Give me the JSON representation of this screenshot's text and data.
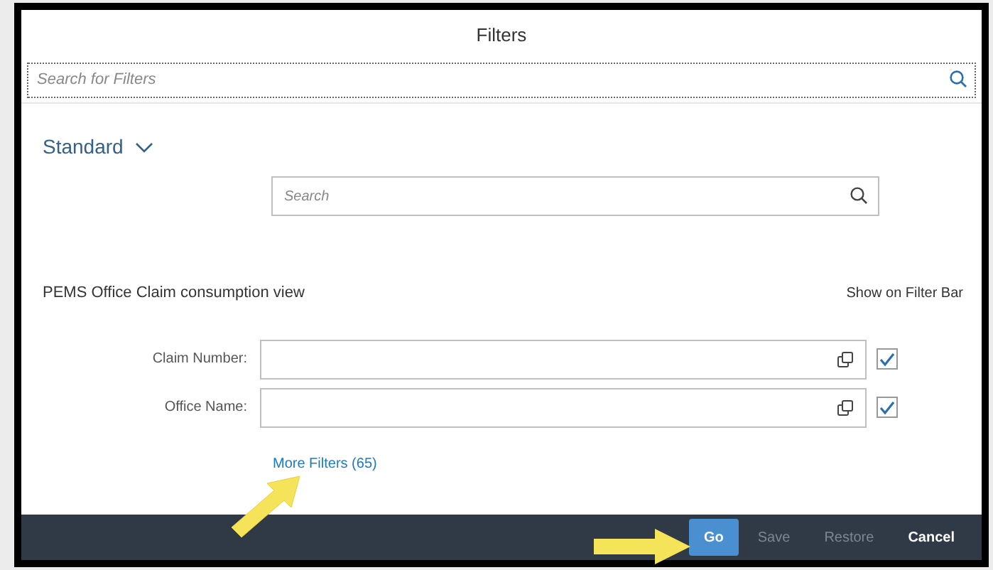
{
  "dialog": {
    "title": "Filters"
  },
  "filter_search": {
    "placeholder": "Search for Filters"
  },
  "variant": {
    "label": "Standard"
  },
  "list_search": {
    "placeholder": "Search"
  },
  "group": {
    "title": "PEMS Office Claim consumption view",
    "column_header": "Show on Filter Bar"
  },
  "fields": [
    {
      "label": "Claim Number:",
      "checked": true
    },
    {
      "label": "Office Name:",
      "checked": true
    }
  ],
  "more_filters": "More Filters (65)",
  "footer_buttons": [
    {
      "label": "Go",
      "kind": "primary",
      "disabled": false
    },
    {
      "label": "Save",
      "kind": "plain",
      "disabled": true
    },
    {
      "label": "Restore",
      "kind": "plain",
      "disabled": true
    },
    {
      "label": "Cancel",
      "kind": "plain",
      "disabled": false
    }
  ]
}
